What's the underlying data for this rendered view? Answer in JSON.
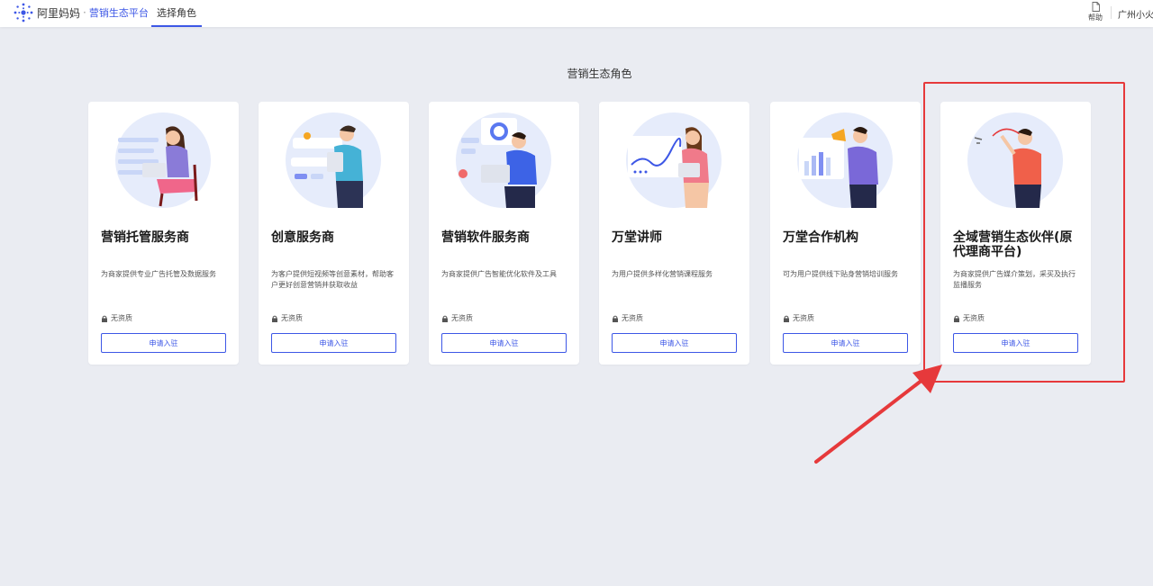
{
  "header": {
    "brand_name": "阿里妈妈",
    "brand_sep": "·",
    "platform_name": "营销生态平台",
    "tab_label": "选择角色",
    "help_label": "帮助",
    "user_name": "广州小火",
    "accent_color": "#3d57e6"
  },
  "main": {
    "section_title": "营销生态角色",
    "cards": [
      {
        "title": "营销托管服务商",
        "desc": "为商家提供专业广告托管及数据服务",
        "qualification": "无资质",
        "button": "申请入驻",
        "illustration": "woman-with-laptop-illustration"
      },
      {
        "title": "创意服务商",
        "desc": "为客户提供短视频等创意素材，帮助客户更好创意营销并获取收益",
        "qualification": "无资质",
        "button": "申请入驻",
        "illustration": "man-with-tablet-illustration"
      },
      {
        "title": "营销软件服务商",
        "desc": "为商家提供广告智能优化软件及工具",
        "qualification": "无资质",
        "button": "申请入驻",
        "illustration": "man-at-laptop-illustration"
      },
      {
        "title": "万堂讲师",
        "desc": "为用户提供多样化营销课程服务",
        "qualification": "无资质",
        "button": "申请入驻",
        "illustration": "woman-presenting-illustration"
      },
      {
        "title": "万堂合作机构",
        "desc": "可为用户提供线下贴身营销培训服务",
        "qualification": "无资质",
        "button": "申请入驻",
        "illustration": "man-with-megaphone-illustration"
      },
      {
        "title": "全域营销生态伙伴(原代理商平台)",
        "desc": "为商家提供广告媒介策划，采买及执行监播服务",
        "qualification": "无资质",
        "button": "申请入驻",
        "illustration": "man-pointing-illustration"
      }
    ]
  },
  "annotation": {
    "color": "#e6393b",
    "highlighted_card": "全域营销生态伙伴(原代理商平台)"
  }
}
